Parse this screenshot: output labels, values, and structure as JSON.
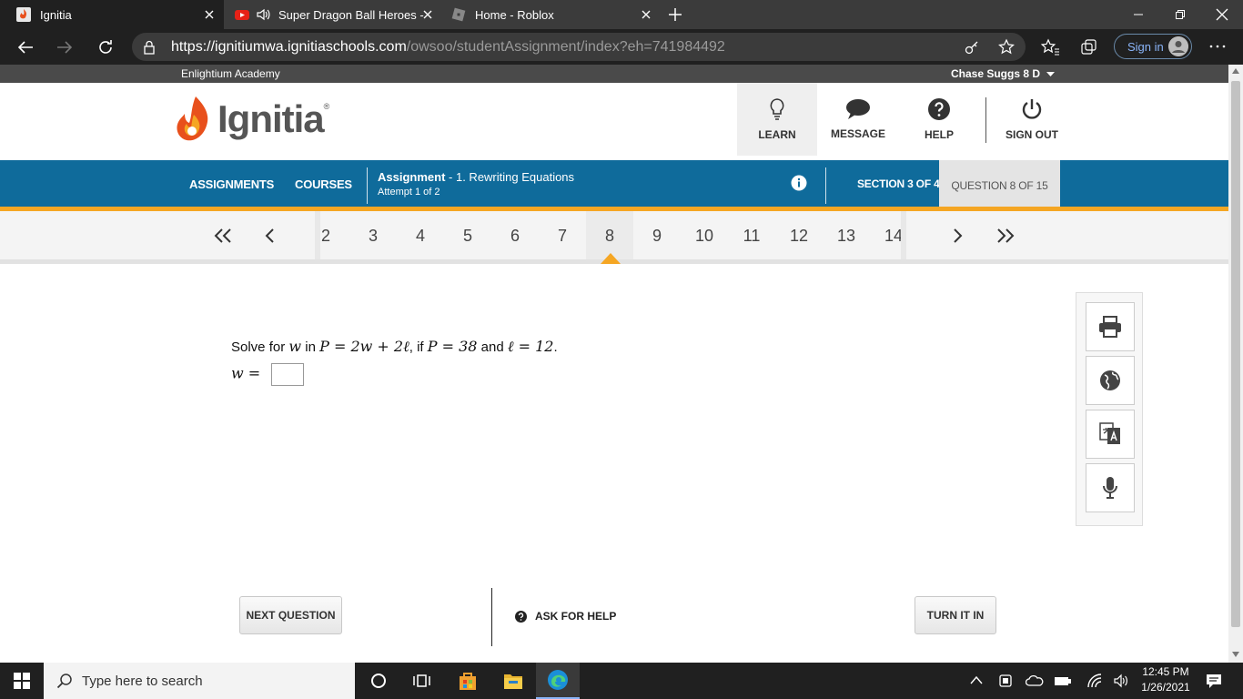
{
  "browser": {
    "tabs": [
      {
        "title": "Ignitia",
        "active": true
      },
      {
        "title": "Super Dragon Ball Heroes -",
        "active": false
      },
      {
        "title": "Home - Roblox",
        "active": false
      }
    ],
    "url_host": "https://ignitiumwa.ignitiaschools.com",
    "url_path": "/owsoo/studentAssignment/index?eh=741984492",
    "sign_in_label": "Sign in"
  },
  "site": {
    "school": "Enlightium Academy",
    "user": "Chase Suggs 8 D",
    "logo_text": "Ignitia",
    "header_buttons": [
      {
        "label": "LEARN",
        "icon": "lightbulb-icon"
      },
      {
        "label": "MESSAGE",
        "icon": "speech-bubble-icon"
      },
      {
        "label": "HELP",
        "icon": "question-circle-icon"
      },
      {
        "label": "SIGN OUT",
        "icon": "power-icon"
      }
    ]
  },
  "nav": {
    "assignments": "ASSIGNMENTS",
    "courses": "COURSES",
    "assignment_label": "Assignment",
    "assignment_title": "- 1. Rewriting Equations",
    "attempt": "Attempt 1 of 2",
    "section": "SECTION 3 OF 4",
    "question": "QUESTION 8 OF 15"
  },
  "question_nav": {
    "numbers": [
      "2",
      "3",
      "4",
      "5",
      "6",
      "7",
      "8",
      "9",
      "10",
      "11",
      "12",
      "13",
      "14"
    ],
    "current": "8"
  },
  "question": {
    "prefix": "Solve for",
    "var": "w",
    "mid1": "in",
    "equation": "P = 2w + 2ℓ",
    "mid2": ", if",
    "cond1": "P = 38",
    "and": "and",
    "cond2": "ℓ = 12",
    "end": ".",
    "answer_label": "w =",
    "answer_value": ""
  },
  "tools": [
    "printer-icon",
    "globe-icon",
    "translate-icon",
    "microphone-icon"
  ],
  "buttons": {
    "next": "NEXT QUESTION",
    "help": "ASK FOR HELP",
    "turn_in": "TURN IT IN"
  },
  "taskbar": {
    "search_placeholder": "Type here to search",
    "time": "12:45 PM",
    "date": "1/26/2021"
  },
  "colors": {
    "blue_bar": "#0f6b9b",
    "accent_orange": "#f5a623"
  }
}
